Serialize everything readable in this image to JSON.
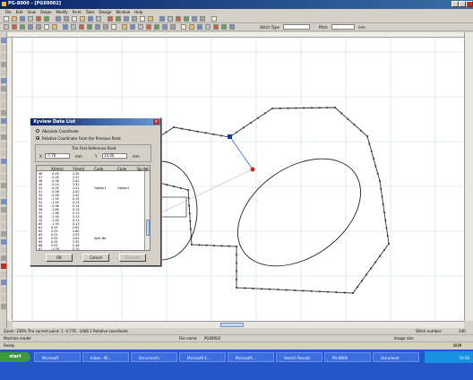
{
  "window": {
    "title": "PG-8000 - [PG09002]",
    "colors": {
      "titlebar": "#0a246a",
      "desktop_taskbar": "#2456c8",
      "path_red": "#c03020",
      "point_blue": "#1a3a9a"
    }
  },
  "menu": [
    "File",
    "Edit",
    "View",
    "Shape",
    "Modify",
    "Point",
    "Tools",
    "Design",
    "Window",
    "Help"
  ],
  "toolbar": {
    "stitch_type_label": "Stitch Type",
    "pitch_label": "Pitch",
    "pitch_unit": "mm"
  },
  "dialog": {
    "title": "Xyview Data List",
    "radio_absolute": "Absolute Coordinate",
    "radio_relative": "Relative Coordinate From the Previous Point",
    "first_ref_label": "The First Reference Point",
    "x_label": "X",
    "x_value": "-7.70",
    "x_unit": "mm",
    "y_label": "Y",
    "y_value": "14.00",
    "y_unit": "mm",
    "columns": [
      "X(mm)",
      "Y(mm)",
      "Code",
      "Code",
      "Sp.dat"
    ],
    "rows": [
      [
        "46",
        "-0.05",
        "2.55",
        "",
        ""
      ],
      [
        "47",
        "-0.05",
        "2.51",
        "",
        ""
      ],
      [
        "48",
        "-0.06",
        "2.50",
        "",
        ""
      ],
      [
        "49",
        "-0.10",
        "2.51",
        "",
        ""
      ],
      [
        "50",
        "-0.05",
        "2.51",
        "Option1",
        "Option2"
      ],
      [
        "51",
        "-0.08",
        "2.50",
        "",
        ""
      ],
      [
        "52",
        "-0.06",
        "2.45",
        "",
        ""
      ],
      [
        "53",
        "-1.95",
        "0.15",
        "",
        ""
      ],
      [
        "54",
        "-1.95",
        "0.13",
        "",
        ""
      ],
      [
        "55",
        "-0.06",
        "0.14",
        "",
        ""
      ],
      [
        "56",
        "-1.89",
        "0.13",
        "",
        ""
      ],
      [
        "57",
        "-1.96",
        "0.13",
        "",
        ""
      ],
      [
        "58",
        "-1.95",
        "0.13",
        "",
        ""
      ],
      [
        "59",
        "-1.95",
        "0.13",
        "",
        ""
      ],
      [
        "60",
        "-1.95",
        "0.13",
        "",
        ""
      ],
      [
        "61",
        "0.05",
        "2.62",
        "",
        ""
      ],
      [
        "62",
        "0.05",
        "2.60",
        "",
        ""
      ],
      [
        "63",
        "0.03",
        "2.55",
        "",
        ""
      ],
      [
        "64",
        "0.02",
        "2.61",
        "Split No.",
        ""
      ],
      [
        "65",
        "0.05",
        "2.55",
        "",
        ""
      ],
      [
        "66",
        "0.05",
        "2.48",
        "",
        ""
      ],
      [
        "67",
        "-1.76",
        "0.70",
        "",
        ""
      ]
    ],
    "ok_label": "OK",
    "cancel_label": "Cancel",
    "apply_label": "Execute"
  },
  "status": {
    "line1": "Zoom: 339%  The current point: 1  -4.776, -1006.1  Relative coordinate",
    "stitch_number_label": "Stitch number:",
    "stitch_number": "140",
    "machine_label": "Machine model",
    "file_label": "File name:",
    "file_name": "PG09002",
    "image_size_label": "Image size",
    "ready": "Ready",
    "caps": "NUM"
  },
  "taskbar": {
    "start": "start",
    "tabs": [
      "Microsoft",
      "Inbox - Mi...",
      "Documents",
      "Microsoft E...",
      "Microsoft...",
      "Search Results",
      "PG-8000",
      "Document"
    ],
    "clock": "10:36"
  }
}
